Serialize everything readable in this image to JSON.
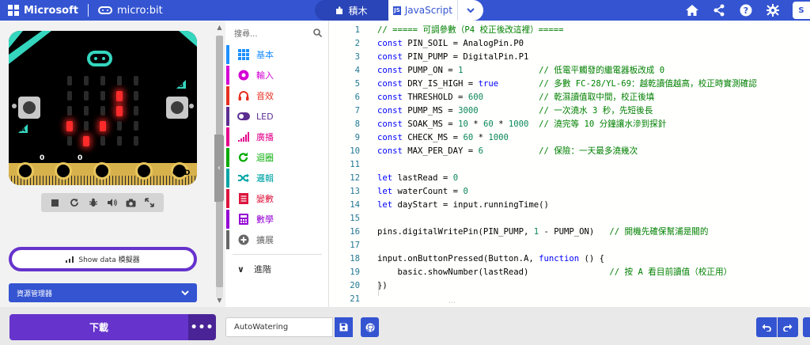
{
  "topbar": {
    "brand": "Microsoft",
    "product": "micro:bit",
    "tab_blocks": "積木",
    "tab_js_badge": "JS",
    "tab_js": "JavaScript",
    "avatar_initial": "S",
    "icons": [
      "home-icon",
      "share-icon",
      "help-icon",
      "settings-icon"
    ]
  },
  "simulator": {
    "pins": [
      {
        "num": "0",
        "label": "0"
      },
      {
        "num": "0",
        "label": "1"
      },
      {
        "num": "",
        "label": "2"
      },
      {
        "num": "",
        "label": "3V"
      },
      {
        "num": "",
        "label": "GND"
      }
    ],
    "button_a": "A",
    "button_b": "B",
    "leds": [
      [
        0,
        0,
        0,
        0,
        0
      ],
      [
        0,
        0,
        0,
        1,
        0
      ],
      [
        0,
        0,
        0,
        1,
        0
      ],
      [
        1,
        0,
        1,
        0,
        0
      ],
      [
        0,
        1,
        0,
        0,
        0
      ]
    ],
    "show_data_label": "Show data  模擬器",
    "explorer_label": "資源管理器"
  },
  "toolbox": {
    "search_placeholder": "搜尋...",
    "categories": [
      {
        "label": "基本",
        "color": "#1e90ff"
      },
      {
        "label": "輸入",
        "color": "#d400d4"
      },
      {
        "label": "音效",
        "color": "#e63022"
      },
      {
        "label": "LED",
        "color": "#5c2d91"
      },
      {
        "label": "廣播",
        "color": "#e3008c"
      },
      {
        "label": "迴圈",
        "color": "#00aa00"
      },
      {
        "label": "邏輯",
        "color": "#00a4a6"
      },
      {
        "label": "變數",
        "color": "#dc143c"
      },
      {
        "label": "數學",
        "color": "#9400d3"
      },
      {
        "label": "擴展",
        "color": "#666666"
      }
    ],
    "advanced_label": "進階"
  },
  "editor": {
    "lines": [
      {
        "n": "1",
        "segs": [
          {
            "t": "// ===== 可調參數（P4 校正後改這裡）=====",
            "c": "cm"
          }
        ]
      },
      {
        "n": "2",
        "segs": [
          {
            "t": "const",
            "c": "kw"
          },
          {
            "t": " PIN_SOIL = AnalogPin.P0",
            "c": ""
          }
        ]
      },
      {
        "n": "3",
        "segs": [
          {
            "t": "const",
            "c": "kw"
          },
          {
            "t": " PIN_PUMP = DigitalPin.P1",
            "c": ""
          }
        ]
      },
      {
        "n": "4",
        "segs": [
          {
            "t": "const",
            "c": "kw"
          },
          {
            "t": " PUMP_ON = ",
            "c": ""
          },
          {
            "t": "1",
            "c": "nm"
          },
          {
            "t": "               ",
            "c": ""
          },
          {
            "t": "// 低電平觸發的繼電器板改成 0",
            "c": "cm"
          }
        ]
      },
      {
        "n": "5",
        "segs": [
          {
            "t": "const",
            "c": "kw"
          },
          {
            "t": " DRY_IS_HIGH = ",
            "c": ""
          },
          {
            "t": "true",
            "c": "kw"
          },
          {
            "t": "        ",
            "c": ""
          },
          {
            "t": "// 多數 FC-28/YL-69：越乾讀值越高，校正時實測確認",
            "c": "cm"
          }
        ]
      },
      {
        "n": "6",
        "segs": [
          {
            "t": "const",
            "c": "kw"
          },
          {
            "t": " THRESHOLD = ",
            "c": ""
          },
          {
            "t": "600",
            "c": "nm"
          },
          {
            "t": "           ",
            "c": ""
          },
          {
            "t": "// 乾濕讀值取中間，校正後填",
            "c": "cm"
          }
        ]
      },
      {
        "n": "7",
        "segs": [
          {
            "t": "const",
            "c": "kw"
          },
          {
            "t": " PUMP_MS = ",
            "c": ""
          },
          {
            "t": "3000",
            "c": "nm"
          },
          {
            "t": "            ",
            "c": ""
          },
          {
            "t": "// 一次澆水 3 秒，先短後長",
            "c": "cm"
          }
        ]
      },
      {
        "n": "8",
        "segs": [
          {
            "t": "const",
            "c": "kw"
          },
          {
            "t": " SOAK_MS = ",
            "c": ""
          },
          {
            "t": "10",
            "c": "nm"
          },
          {
            "t": " * ",
            "c": ""
          },
          {
            "t": "60",
            "c": "nm"
          },
          {
            "t": " * ",
            "c": ""
          },
          {
            "t": "1000",
            "c": "nm"
          },
          {
            "t": "  ",
            "c": ""
          },
          {
            "t": "// 澆完等 10 分鐘讓水滲到探針",
            "c": "cm"
          }
        ]
      },
      {
        "n": "9",
        "segs": [
          {
            "t": "const",
            "c": "kw"
          },
          {
            "t": " CHECK_MS = ",
            "c": ""
          },
          {
            "t": "60",
            "c": "nm"
          },
          {
            "t": " * ",
            "c": ""
          },
          {
            "t": "1000",
            "c": "nm"
          }
        ]
      },
      {
        "n": "10",
        "segs": [
          {
            "t": "const",
            "c": "kw"
          },
          {
            "t": " MAX_PER_DAY = ",
            "c": ""
          },
          {
            "t": "6",
            "c": "nm"
          },
          {
            "t": "           ",
            "c": ""
          },
          {
            "t": "// 保險：一天最多澆幾次",
            "c": "cm"
          }
        ]
      },
      {
        "n": "11",
        "segs": []
      },
      {
        "n": "12",
        "segs": [
          {
            "t": "let",
            "c": "kw"
          },
          {
            "t": " lastRead = ",
            "c": ""
          },
          {
            "t": "0",
            "c": "nm"
          }
        ]
      },
      {
        "n": "13",
        "segs": [
          {
            "t": "let",
            "c": "kw"
          },
          {
            "t": " waterCount = ",
            "c": ""
          },
          {
            "t": "0",
            "c": "nm"
          }
        ]
      },
      {
        "n": "14",
        "segs": [
          {
            "t": "let",
            "c": "kw"
          },
          {
            "t": " dayStart = input.runningTime()",
            "c": ""
          }
        ]
      },
      {
        "n": "15",
        "segs": []
      },
      {
        "n": "16",
        "segs": [
          {
            "t": "pins.digitalWritePin(PIN_PUMP, ",
            "c": ""
          },
          {
            "t": "1",
            "c": "nm"
          },
          {
            "t": " - PUMP_ON)   ",
            "c": ""
          },
          {
            "t": "// 開機先確保幫浦是關的",
            "c": "cm"
          }
        ]
      },
      {
        "n": "17",
        "segs": []
      },
      {
        "n": "18",
        "segs": [
          {
            "t": "input.onButtonPressed(Button.A, ",
            "c": ""
          },
          {
            "t": "function",
            "c": "kw"
          },
          {
            "t": " () {",
            "c": ""
          }
        ]
      },
      {
        "n": "19",
        "segs": [
          {
            "t": "    basic.showNumber(lastRead)                ",
            "c": ""
          },
          {
            "t": "// 按 A 看目前讀值（校正用）",
            "c": "cm"
          }
        ]
      },
      {
        "n": "20",
        "segs": [
          {
            "t": "})",
            "c": ""
          }
        ]
      },
      {
        "n": "21",
        "segs": []
      }
    ]
  },
  "bottombar": {
    "download_label": "下載",
    "more_label": "•••",
    "project_name": "AutoWatering"
  }
}
